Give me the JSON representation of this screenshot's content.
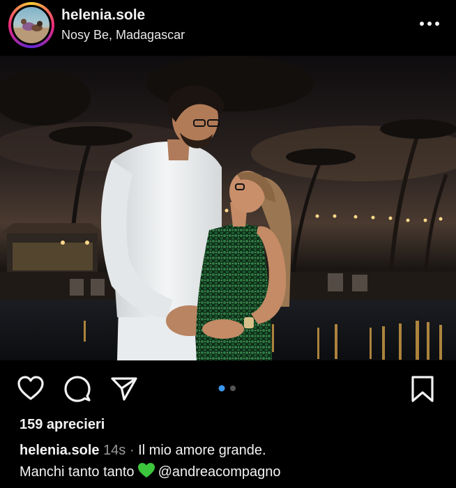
{
  "post": {
    "username": "helenia.sole",
    "location": "Nosy Be, Madagascar",
    "likes": "159 aprecieri",
    "caption_user": "helenia.sole",
    "caption_time": "14s",
    "caption_sep": "·",
    "caption_line1": "Il mio amore grande.",
    "caption_line2": "Manchi tanto tanto",
    "caption_mention": "@andreacompagno"
  },
  "carousel": {
    "current": 1,
    "total": 2
  },
  "icons": {
    "more": "more-horizontal-icon",
    "like": "heart-icon",
    "comment": "comment-bubble-icon",
    "share": "paper-plane-icon",
    "save": "bookmark-icon",
    "emoji": "green-heart-emoji"
  },
  "colors": {
    "background": "#000000",
    "text": "#f2f2f2",
    "muted": "#9a9a9a",
    "carousel_active": "#3897f0",
    "carousel_inactive": "#555555",
    "emoji_green": "#3cc63c"
  }
}
